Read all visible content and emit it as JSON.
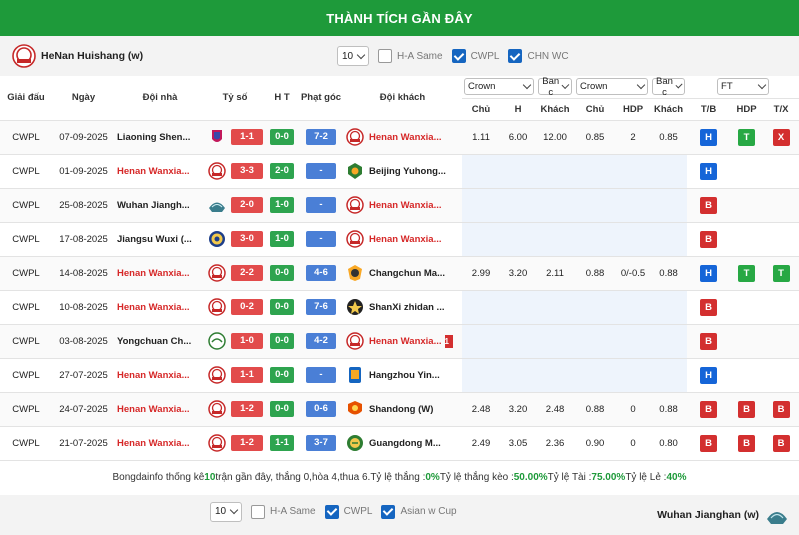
{
  "title": "THÀNH TÍCH GẦN ĐÂY",
  "top": {
    "team_name": "HeNan Huishang (w)",
    "count": "10",
    "checks": [
      {
        "label": "H-A Same",
        "on": false
      },
      {
        "label": "CWPL",
        "on": true
      },
      {
        "label": "CHN WC",
        "on": true
      }
    ]
  },
  "headers": {
    "league": "Giải đấu",
    "date": "Ngày",
    "home": "Đội nhà",
    "score": "Tỷ số",
    "ht": "H T",
    "corner": "Phạt góc",
    "away": "Đội khách",
    "crown1": "Crown",
    "ban1": "Ban c",
    "crown2": "Crown",
    "ban2": "Ban c",
    "ft": "FT",
    "chu1": "Chủ",
    "h": "H",
    "khach1": "Khách",
    "chu2": "Chủ",
    "hdp": "HDP",
    "khach2": "Khách",
    "tb": "T/B",
    "hdp2": "HDP",
    "tx": "T/X"
  },
  "rows": [
    {
      "league": "CWPL",
      "date": "07-09-2025",
      "home": "Liaoning Shen...",
      "home_hl": false,
      "home_logo": "liaoning",
      "score": "1-1",
      "ht": "0-0",
      "corner": "7-2",
      "away_logo": "henan",
      "away": "Henan Wanxia...",
      "away_hl": true,
      "o1": "1.11",
      "o2": "6.00",
      "o3": "12.00",
      "a1": "0.85",
      "a2": "2",
      "a3": "0.85",
      "r1": "H",
      "r2": "T",
      "r3": "X"
    },
    {
      "league": "CWPL",
      "date": "01-09-2025",
      "home": "Henan Wanxia...",
      "home_hl": true,
      "home_logo": "henan",
      "score": "3-3",
      "ht": "2-0",
      "corner": "-",
      "away_logo": "beijing",
      "away": "Beijing Yuhong...",
      "away_hl": false,
      "o1": "",
      "o2": "",
      "o3": "",
      "a1": "",
      "a2": "",
      "a3": "",
      "r1": "H",
      "r2": "",
      "r3": ""
    },
    {
      "league": "CWPL",
      "date": "25-08-2025",
      "home": "Wuhan Jiangh...",
      "home_hl": false,
      "home_logo": "wuhan",
      "score": "2-0",
      "ht": "1-0",
      "corner": "-",
      "away_logo": "henan",
      "away": "Henan Wanxia...",
      "away_hl": true,
      "o1": "",
      "o2": "",
      "o3": "",
      "a1": "",
      "a2": "",
      "a3": "",
      "r1": "B",
      "r2": "",
      "r3": ""
    },
    {
      "league": "CWPL",
      "date": "17-08-2025",
      "home": "Jiangsu Wuxi (...",
      "home_hl": false,
      "home_logo": "jiangsu",
      "score": "3-0",
      "ht": "1-0",
      "corner": "-",
      "away_logo": "henan",
      "away": "Henan Wanxia...",
      "away_hl": true,
      "o1": "",
      "o2": "",
      "o3": "",
      "a1": "",
      "a2": "",
      "a3": "",
      "r1": "B",
      "r2": "",
      "r3": ""
    },
    {
      "league": "CWPL",
      "date": "14-08-2025",
      "home": "Henan Wanxia...",
      "home_hl": true,
      "home_logo": "henan",
      "score": "2-2",
      "ht": "0-0",
      "corner": "4-6",
      "away_logo": "changchun",
      "away": "Changchun Ma...",
      "away_hl": false,
      "o1": "2.99",
      "o2": "3.20",
      "o3": "2.11",
      "a1": "0.88",
      "a2": "0/-0.5",
      "a3": "0.88",
      "r1": "H",
      "r2": "T",
      "r3": "T"
    },
    {
      "league": "CWPL",
      "date": "10-08-2025",
      "home": "Henan Wanxia...",
      "home_hl": true,
      "home_logo": "henan",
      "score": "0-2",
      "ht": "0-0",
      "corner": "7-6",
      "away_logo": "shanxi",
      "away": "ShanXi zhidan ...",
      "away_hl": false,
      "o1": "",
      "o2": "",
      "o3": "",
      "a1": "",
      "a2": "",
      "a3": "",
      "r1": "B",
      "r2": "",
      "r3": ""
    },
    {
      "league": "CWPL",
      "date": "03-08-2025",
      "home": "Yongchuan Ch...",
      "home_hl": false,
      "home_logo": "yongchuan",
      "score": "1-0",
      "ht": "0-0",
      "corner": "4-2",
      "away_logo": "henan",
      "away": "Henan Wanxia...",
      "away_hl": true,
      "redcard": "1",
      "o1": "",
      "o2": "",
      "o3": "",
      "a1": "",
      "a2": "",
      "a3": "",
      "r1": "B",
      "r2": "",
      "r3": ""
    },
    {
      "league": "CWPL",
      "date": "27-07-2025",
      "home": "Henan Wanxia...",
      "home_hl": true,
      "home_logo": "henan",
      "score": "1-1",
      "ht": "0-0",
      "corner": "-",
      "away_logo": "hangzhou",
      "away": "Hangzhou Yin...",
      "away_hl": false,
      "o1": "",
      "o2": "",
      "o3": "",
      "a1": "",
      "a2": "",
      "a3": "",
      "r1": "H",
      "r2": "",
      "r3": ""
    },
    {
      "league": "CWPL",
      "date": "24-07-2025",
      "home": "Henan Wanxia...",
      "home_hl": true,
      "home_logo": "henan",
      "score": "1-2",
      "ht": "0-0",
      "corner": "0-6",
      "away_logo": "shandong",
      "away": "Shandong (W)",
      "away_hl": false,
      "o1": "2.48",
      "o2": "3.20",
      "o3": "2.48",
      "a1": "0.88",
      "a2": "0",
      "a3": "0.88",
      "r1": "B",
      "r2": "B",
      "r3": "B"
    },
    {
      "league": "CWPL",
      "date": "21-07-2025",
      "home": "Henan Wanxia...",
      "home_hl": true,
      "home_logo": "henan",
      "score": "1-2",
      "ht": "1-1",
      "corner": "3-7",
      "away_logo": "guangdong",
      "away": "Guangdong M...",
      "away_hl": false,
      "o1": "2.49",
      "o2": "3.05",
      "o3": "2.36",
      "a1": "0.90",
      "a2": "0",
      "a3": "0.80",
      "r1": "B",
      "r2": "B",
      "r3": "B"
    }
  ],
  "stats": {
    "p1": "Bongdainfo thống kê ",
    "n": "10",
    "p2": " trận gần đây, thắng 0,hòa 4,thua 6.Tỷ lệ thắng : ",
    "win": "0%",
    "p3": " Tỷ lệ thắng kèo : ",
    "hdp": "50.00%",
    "p4": " Tỷ lệ Tài : ",
    "tai": "75.00%",
    "p5": " Tỷ lệ Lẻ : ",
    "le": "40%"
  },
  "bottom": {
    "count": "10",
    "checks": [
      {
        "label": "H-A Same",
        "on": false
      },
      {
        "label": "CWPL",
        "on": true
      },
      {
        "label": "Asian w Cup",
        "on": true
      }
    ],
    "team_name": "Wuhan Jianghan (w)"
  },
  "colors": {
    "green": "#1e9a3a",
    "red": "#d32f2f",
    "blue": "#1565d8",
    "corner_blue": "#4a7fd6"
  }
}
